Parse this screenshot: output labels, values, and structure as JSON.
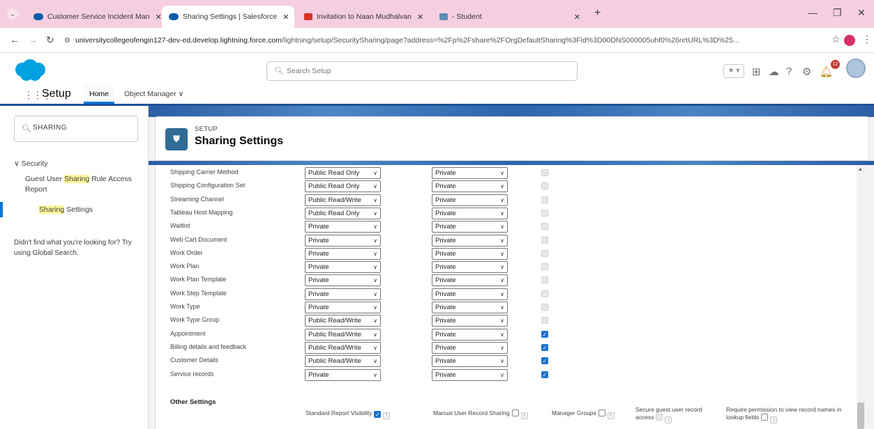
{
  "browser": {
    "tabs": [
      {
        "title": "Customer Service Incident Man",
        "favicon_color": "#0b5cab"
      },
      {
        "title": "Sharing Settings | Salesforce",
        "favicon_color": "#0b5cab"
      },
      {
        "title": "Invitation to Naan Mudhalvan",
        "favicon_color": "#d93025"
      },
      {
        "title": "- Student",
        "favicon_color": "#5f8bb5"
      }
    ],
    "url_host": "universitycollegeofengin127-dev-ed.develop.lightning.force.com",
    "url_path": "/lightning/setup/SecuritySharing/page?address=%2Fp%2Fshare%2FOrgDefaultSharing%3Fid%3D00DNS000005uhf0%26retURL%3D%25..."
  },
  "header": {
    "search_placeholder": "Search Setup",
    "notification_count": "12",
    "brand_color": "#00a1e0"
  },
  "app_nav": {
    "app_name": "Setup",
    "home": "Home",
    "object_manager": "Object Manager"
  },
  "sidebar": {
    "quick_find_value": "SHARING",
    "node": "Security",
    "item1_pre": "Guest User ",
    "item1_hl": "Sharing",
    "item1_post": " Rule Access Report",
    "item2_hl": "Sharing",
    "item2_post": " Settings",
    "help_text": "Didn't find what you're looking for? Try using Global Search."
  },
  "page": {
    "eyebrow": "SETUP",
    "title": "Sharing Settings"
  },
  "sharing_rows": [
    {
      "object": "Shipping Carrier Method",
      "default_internal": "Public Read Only",
      "default_external": "Private",
      "grant_hierarchy": false
    },
    {
      "object": "Shipping Configuration Set",
      "default_internal": "Public Read Only",
      "default_external": "Private",
      "grant_hierarchy": false
    },
    {
      "object": "Streaming Channel",
      "default_internal": "Public Read/Write",
      "default_external": "Private",
      "grant_hierarchy": false
    },
    {
      "object": "Tableau Host Mapping",
      "default_internal": "Public Read Only",
      "default_external": "Private",
      "grant_hierarchy": false
    },
    {
      "object": "Waitlist",
      "default_internal": "Private",
      "default_external": "Private",
      "grant_hierarchy": false
    },
    {
      "object": "Web Cart Document",
      "default_internal": "Private",
      "default_external": "Private",
      "grant_hierarchy": false
    },
    {
      "object": "Work Order",
      "default_internal": "Private",
      "default_external": "Private",
      "grant_hierarchy": false
    },
    {
      "object": "Work Plan",
      "default_internal": "Private",
      "default_external": "Private",
      "grant_hierarchy": false
    },
    {
      "object": "Work Plan Template",
      "default_internal": "Private",
      "default_external": "Private",
      "grant_hierarchy": false
    },
    {
      "object": "Work Step Template",
      "default_internal": "Private",
      "default_external": "Private",
      "grant_hierarchy": false
    },
    {
      "object": "Work Type",
      "default_internal": "Private",
      "default_external": "Private",
      "grant_hierarchy": false
    },
    {
      "object": "Work Type Group",
      "default_internal": "Public Read/Write",
      "default_external": "Private",
      "grant_hierarchy": false
    },
    {
      "object": "Appointment",
      "default_internal": "Public Read/Write",
      "default_external": "Private",
      "grant_hierarchy": true
    },
    {
      "object": "Billing details and feedback",
      "default_internal": "Public Read/Write",
      "default_external": "Private",
      "grant_hierarchy": true
    },
    {
      "object": "Customer Details",
      "default_internal": "Public Read/Write",
      "default_external": "Private",
      "grant_hierarchy": true
    },
    {
      "object": "Service records",
      "default_internal": "Private",
      "default_external": "Private",
      "grant_hierarchy": true
    }
  ],
  "other_settings": {
    "title": "Other Settings",
    "standard_report_visibility": "Standard Report Visibility",
    "manual_user_record_sharing": "Manual User Record Sharing",
    "manager_groups": "Manager Groups",
    "secure_guest_access": "Secure guest user record access",
    "require_permission": "Require permission to view record names in lookup fields"
  }
}
